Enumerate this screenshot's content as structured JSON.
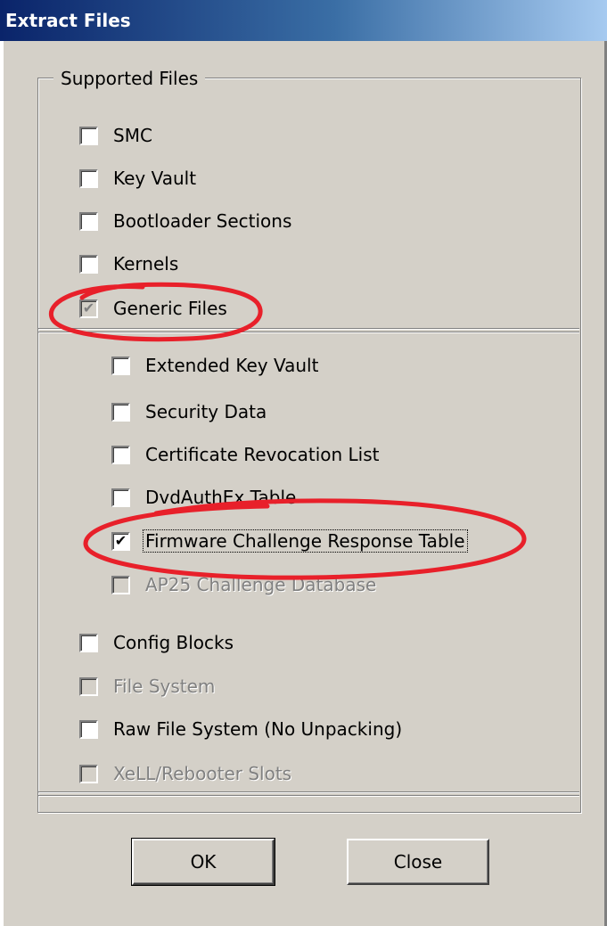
{
  "window": {
    "title": "Extract Files"
  },
  "group": {
    "label": "Supported Files"
  },
  "options": [
    {
      "label": "SMC",
      "checked": false,
      "disabled": false
    },
    {
      "label": "Key Vault",
      "checked": false,
      "disabled": false
    },
    {
      "label": "Bootloader Sections",
      "checked": false,
      "disabled": false
    },
    {
      "label": "Kernels",
      "checked": false,
      "disabled": false
    },
    {
      "label": "Generic Files",
      "checked": true,
      "disabled": true
    }
  ],
  "generic_options": [
    {
      "label": "Extended Key Vault",
      "checked": false,
      "disabled": false
    },
    {
      "label": "Security Data",
      "checked": false,
      "disabled": false
    },
    {
      "label": "Certificate Revocation List",
      "checked": false,
      "disabled": false
    },
    {
      "label": "DvdAuthEx Table",
      "checked": false,
      "disabled": false
    },
    {
      "label": "Firmware Challenge Response Table",
      "checked": true,
      "disabled": false,
      "focused": true
    },
    {
      "label": "AP25 Challenge Database",
      "checked": false,
      "disabled": true
    }
  ],
  "other_options": [
    {
      "label": "Config Blocks",
      "checked": false,
      "disabled": false
    },
    {
      "label": "File System",
      "checked": false,
      "disabled": true
    },
    {
      "label": "Raw File System (No Unpacking)",
      "checked": false,
      "disabled": false
    },
    {
      "label": "XeLL/Rebooter Slots",
      "checked": false,
      "disabled": true
    }
  ],
  "buttons": {
    "ok": "OK",
    "close": "Close"
  },
  "checkmark": "✔",
  "annotation_color": "#e8202a"
}
